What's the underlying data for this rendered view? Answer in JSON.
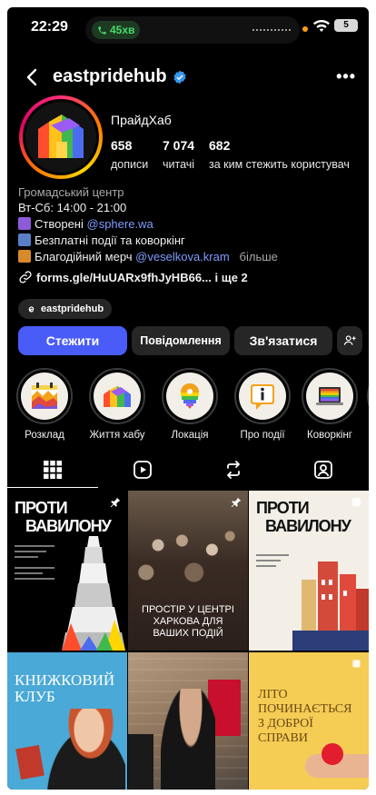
{
  "status_bar": {
    "time": "22:29",
    "call_duration": "45хв",
    "battery": "5"
  },
  "header": {
    "username": "eastpridehub",
    "back_icon": "chevron-left-icon",
    "more_icon": "ellipsis-icon"
  },
  "profile": {
    "full_name": "ПрайдХаб",
    "stats": [
      {
        "value": "658",
        "label": "дописи"
      },
      {
        "value": "7 074",
        "label": "читачі"
      },
      {
        "value": "682",
        "label": "за ким стежить користувач"
      }
    ],
    "bio": {
      "category": "Громадський центр",
      "hours": "Вт-Сб: 14:00 - 21:00",
      "created_prefix": "Створені",
      "created_mention": "@sphere.wa",
      "events": "Безплатні події та коворкінг",
      "merch_prefix": "Благодійний мерч",
      "merch_mention": "@veselkova.kram",
      "more": "більше",
      "link": "forms.gle/HuUARx9fhJyHB66...",
      "link_more": "і ще 2"
    },
    "threads_handle": "eastpridehub"
  },
  "actions": {
    "follow": "Стежити",
    "message": "Повідомлення",
    "contact": "Зв'язатися",
    "add_person_icon": "add-person-icon"
  },
  "highlights": [
    {
      "label": "Розклад",
      "icon": "calendar-icon"
    },
    {
      "label": "Життя хабу",
      "icon": "houses-icon"
    },
    {
      "label": "Локація",
      "icon": "location-pin-icon"
    },
    {
      "label": "Про події",
      "icon": "info-icon"
    },
    {
      "label": "Коворкінг",
      "icon": "laptop-icon"
    }
  ],
  "tabs": [
    {
      "name": "grid",
      "icon": "grid-icon",
      "active": true
    },
    {
      "name": "reels",
      "icon": "reels-icon",
      "active": false
    },
    {
      "name": "reposts",
      "icon": "repost-icon",
      "active": false
    },
    {
      "name": "tagged",
      "icon": "tagged-icon",
      "active": false
    }
  ],
  "posts": [
    {
      "title_line1": "ПРОТИ",
      "title_line2": "ВАВИЛОНУ",
      "pinned": true,
      "colors": [
        "#000000",
        "#ffffff"
      ]
    },
    {
      "title_line1": "ПРОСТІР У ЦЕНТРІ",
      "title_line2": "ХАРКОВА ДЛЯ",
      "title_line3": "ВАШИХ ПОДІЙ",
      "pinned": true,
      "colors": [
        "#3a2c24",
        "#ffffff"
      ]
    },
    {
      "title_line1": "ПРОТИ",
      "title_line2": "ВАВИЛОНУ",
      "pinned": true,
      "colors": [
        "#f3efe6",
        "#111111"
      ]
    },
    {
      "title_line1": "КНИЖКОВИЙ",
      "title_line2": "КЛУБ",
      "pinned": false,
      "colors": [
        "#4aa9d6",
        "#ffffff"
      ]
    },
    {
      "pinned": false,
      "colors": [
        "#a58e76",
        "#111111"
      ]
    },
    {
      "title_line1": "ЛІТО",
      "title_line2": "ПОЧИНАЄТЬСЯ",
      "title_line3": "З ДОБРОЇ",
      "title_line4": "СПРАВИ",
      "pinned": false,
      "colors": [
        "#f5cc54",
        "#6b4a16"
      ]
    }
  ],
  "colors": {
    "accent": "#4a5cf7",
    "mention": "#7f9cff",
    "background": "#000000"
  }
}
